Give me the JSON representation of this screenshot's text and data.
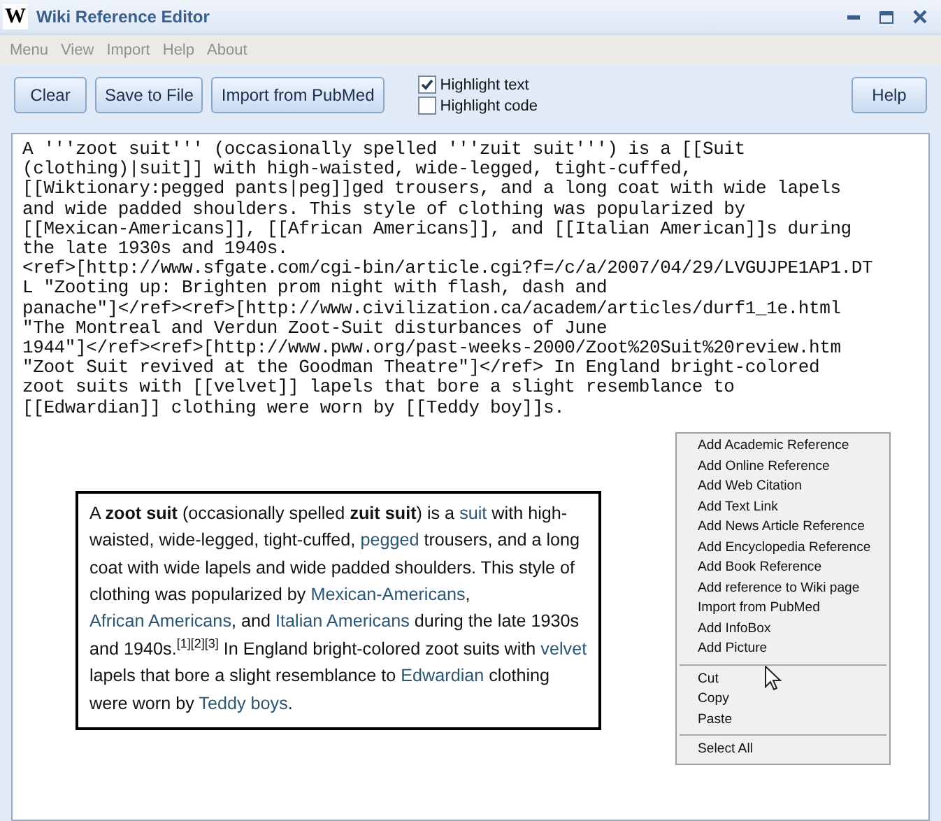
{
  "window": {
    "title": "Wiki Reference Editor",
    "logo": "W"
  },
  "menu_bar": [
    "Menu",
    "View",
    "Import",
    "Help",
    "About"
  ],
  "toolbar": {
    "buttons": [
      "Clear",
      "Save to File",
      "Import from PubMed"
    ],
    "checkboxes": [
      {
        "label": "Highlight text",
        "checked": true
      },
      {
        "label": "Highlight code",
        "checked": false
      }
    ],
    "help_button": "Help"
  },
  "editor": {
    "lines": [
      "A '''zoot suit''' (occasionally spelled '''zuit suit''') is a [[Suit",
      "(clothing)|suit]] with high-waisted, wide-legged, tight-cuffed,",
      "[[Wiktionary:pegged pants|peg]]ged trousers, and a long coat with wide lapels",
      "and wide padded shoulders. This style of clothing was popularized by",
      "[[Mexican-Americans]], [[African Americans]], and [[Italian American]]s during",
      "the late 1930s and 1940s.",
      "<ref>[http://www.sfgate.com/cgi-bin/article.cgi?f=/c/a/2007/04/29/LVGUJPE1AP1.DT",
      "L \"Zooting up: Brighten prom night with flash, dash and",
      "panache\"]</ref><ref>[http://www.civilization.ca/academ/articles/durf1_1e.html",
      "\"The Montreal and Verdun Zoot-Suit disturbances of June",
      "1944\"]</ref><ref>[http://www.pww.org/past-weeks-2000/Zoot%20Suit%20review.htm",
      "\"Zoot Suit revived at the Goodman Theatre\"]</ref> In England bright-colored",
      "zoot suits with [[velvet]] lapels that bore a slight resemblance to",
      "[[Edwardian]] clothing were worn by [[Teddy boy]]s."
    ]
  },
  "preview": [
    {
      "kind": "text",
      "text": "A "
    },
    {
      "kind": "bold",
      "text": "zoot suit"
    },
    {
      "kind": "text",
      "text": " (occasionally spelled "
    },
    {
      "kind": "bold",
      "text": "zuit suit"
    },
    {
      "kind": "text",
      "text": ") is a "
    },
    {
      "kind": "link",
      "text": "suit"
    },
    {
      "kind": "text",
      "text": " with high-waisted, wide-legged, tight-cuffed, "
    },
    {
      "kind": "link",
      "text": "pegged"
    },
    {
      "kind": "text",
      "text": " trousers, and a long coat with wide lapels and wide padded shoulders. This style of clothing was popularized by "
    },
    {
      "kind": "link",
      "text": "Mexican-Americans"
    },
    {
      "kind": "text",
      "text": ", "
    },
    {
      "kind": "link",
      "text": "African Americans"
    },
    {
      "kind": "text",
      "text": ", and "
    },
    {
      "kind": "link",
      "text": "Italian Americans"
    },
    {
      "kind": "text",
      "text": " during the late 1930s and 1940s."
    },
    {
      "kind": "sup",
      "text": "[1][2][3]"
    },
    {
      "kind": "text",
      "text": " In England bright-colored zoot suits with "
    },
    {
      "kind": "link",
      "text": "velvet"
    },
    {
      "kind": "text",
      "text": " lapels that bore a slight resemblance to "
    },
    {
      "kind": "link",
      "text": "Edwardian"
    },
    {
      "kind": "text",
      "text": " clothing were worn by "
    },
    {
      "kind": "link",
      "text": "Teddy boys"
    },
    {
      "kind": "text",
      "text": "."
    }
  ],
  "context_menu": [
    [
      "Add Academic Reference",
      "Add Online Reference",
      "Add Web Citation",
      "Add Text Link",
      "Add News Article Reference",
      "Add Encyclopedia Reference",
      "Add Book Reference",
      "Add reference to Wiki page",
      "Import from PubMed",
      "Add InfoBox",
      "Add Picture"
    ],
    [
      "Cut",
      "Copy",
      "Paste"
    ],
    [
      "Select All"
    ]
  ]
}
